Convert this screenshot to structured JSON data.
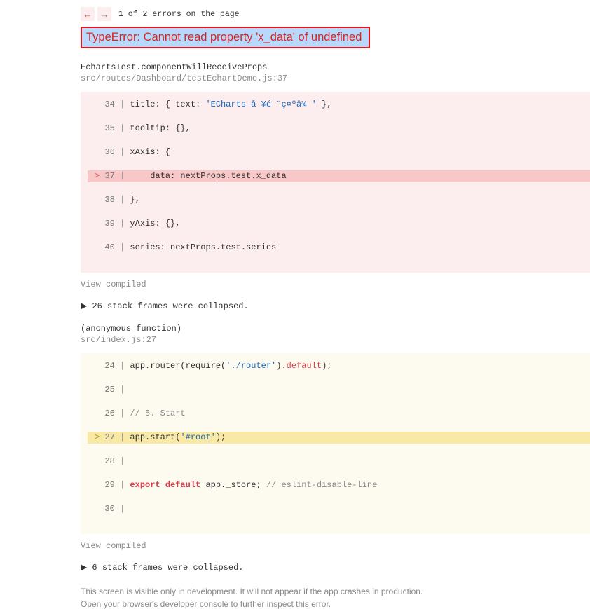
{
  "nav": {
    "prev_icon": "←",
    "next_icon": "→",
    "count_text": "1 of 2 errors on the page"
  },
  "error_title": "TypeError: Cannot read property 'x_data' of undefined",
  "frames": [
    {
      "label": "EchartsTest.componentWillReceiveProps",
      "source": "src/routes/Dashboard/testEchartDemo.js:37",
      "theme": "red",
      "lines": [
        {
          "n": "34",
          "hl": false,
          "html": "title: { text: <span class='cs-str'>'ECharts å ¥é ¨ç¤ºä¾ '</span> },"
        },
        {
          "n": "35",
          "hl": false,
          "html": "tooltip: {},"
        },
        {
          "n": "36",
          "hl": false,
          "html": "xAxis: {"
        },
        {
          "n": "37",
          "hl": true,
          "html": "    data: nextProps.test.x_data"
        },
        {
          "n": "38",
          "hl": false,
          "html": "},"
        },
        {
          "n": "39",
          "hl": false,
          "html": "yAxis: {},"
        },
        {
          "n": "40",
          "hl": false,
          "html": "series: nextProps.test.series"
        }
      ],
      "view_compiled": "View compiled",
      "collapsed": "▶ 26 stack frames were collapsed."
    },
    {
      "label": "(anonymous function)",
      "source": "src/index.js:27",
      "theme": "yellow",
      "lines": [
        {
          "n": "24",
          "hl": false,
          "html": "app.router(require(<span class='cs-str'>'./router'</span>).<span class='cs-def'>default</span>);"
        },
        {
          "n": "25",
          "hl": false,
          "html": ""
        },
        {
          "n": "26",
          "hl": false,
          "html": "<span class='cs-com'>// 5. Start</span>"
        },
        {
          "n": "27",
          "hl": true,
          "html": "app.start(<span class='cs-str'>'#root'</span>);"
        },
        {
          "n": "28",
          "hl": false,
          "html": ""
        },
        {
          "n": "29",
          "hl": false,
          "html": "<span class='cs-key'>export default</span> app._store; <span class='cs-com'>// eslint-disable-line</span>"
        },
        {
          "n": "30",
          "hl": false,
          "html": ""
        }
      ],
      "view_compiled": "View compiled",
      "collapsed": "▶ 6 stack frames were collapsed."
    }
  ],
  "footer": {
    "line1": "This screen is visible only in development. It will not appear if the app crashes in production.",
    "line2": "Open your browser's developer console to further inspect this error."
  }
}
